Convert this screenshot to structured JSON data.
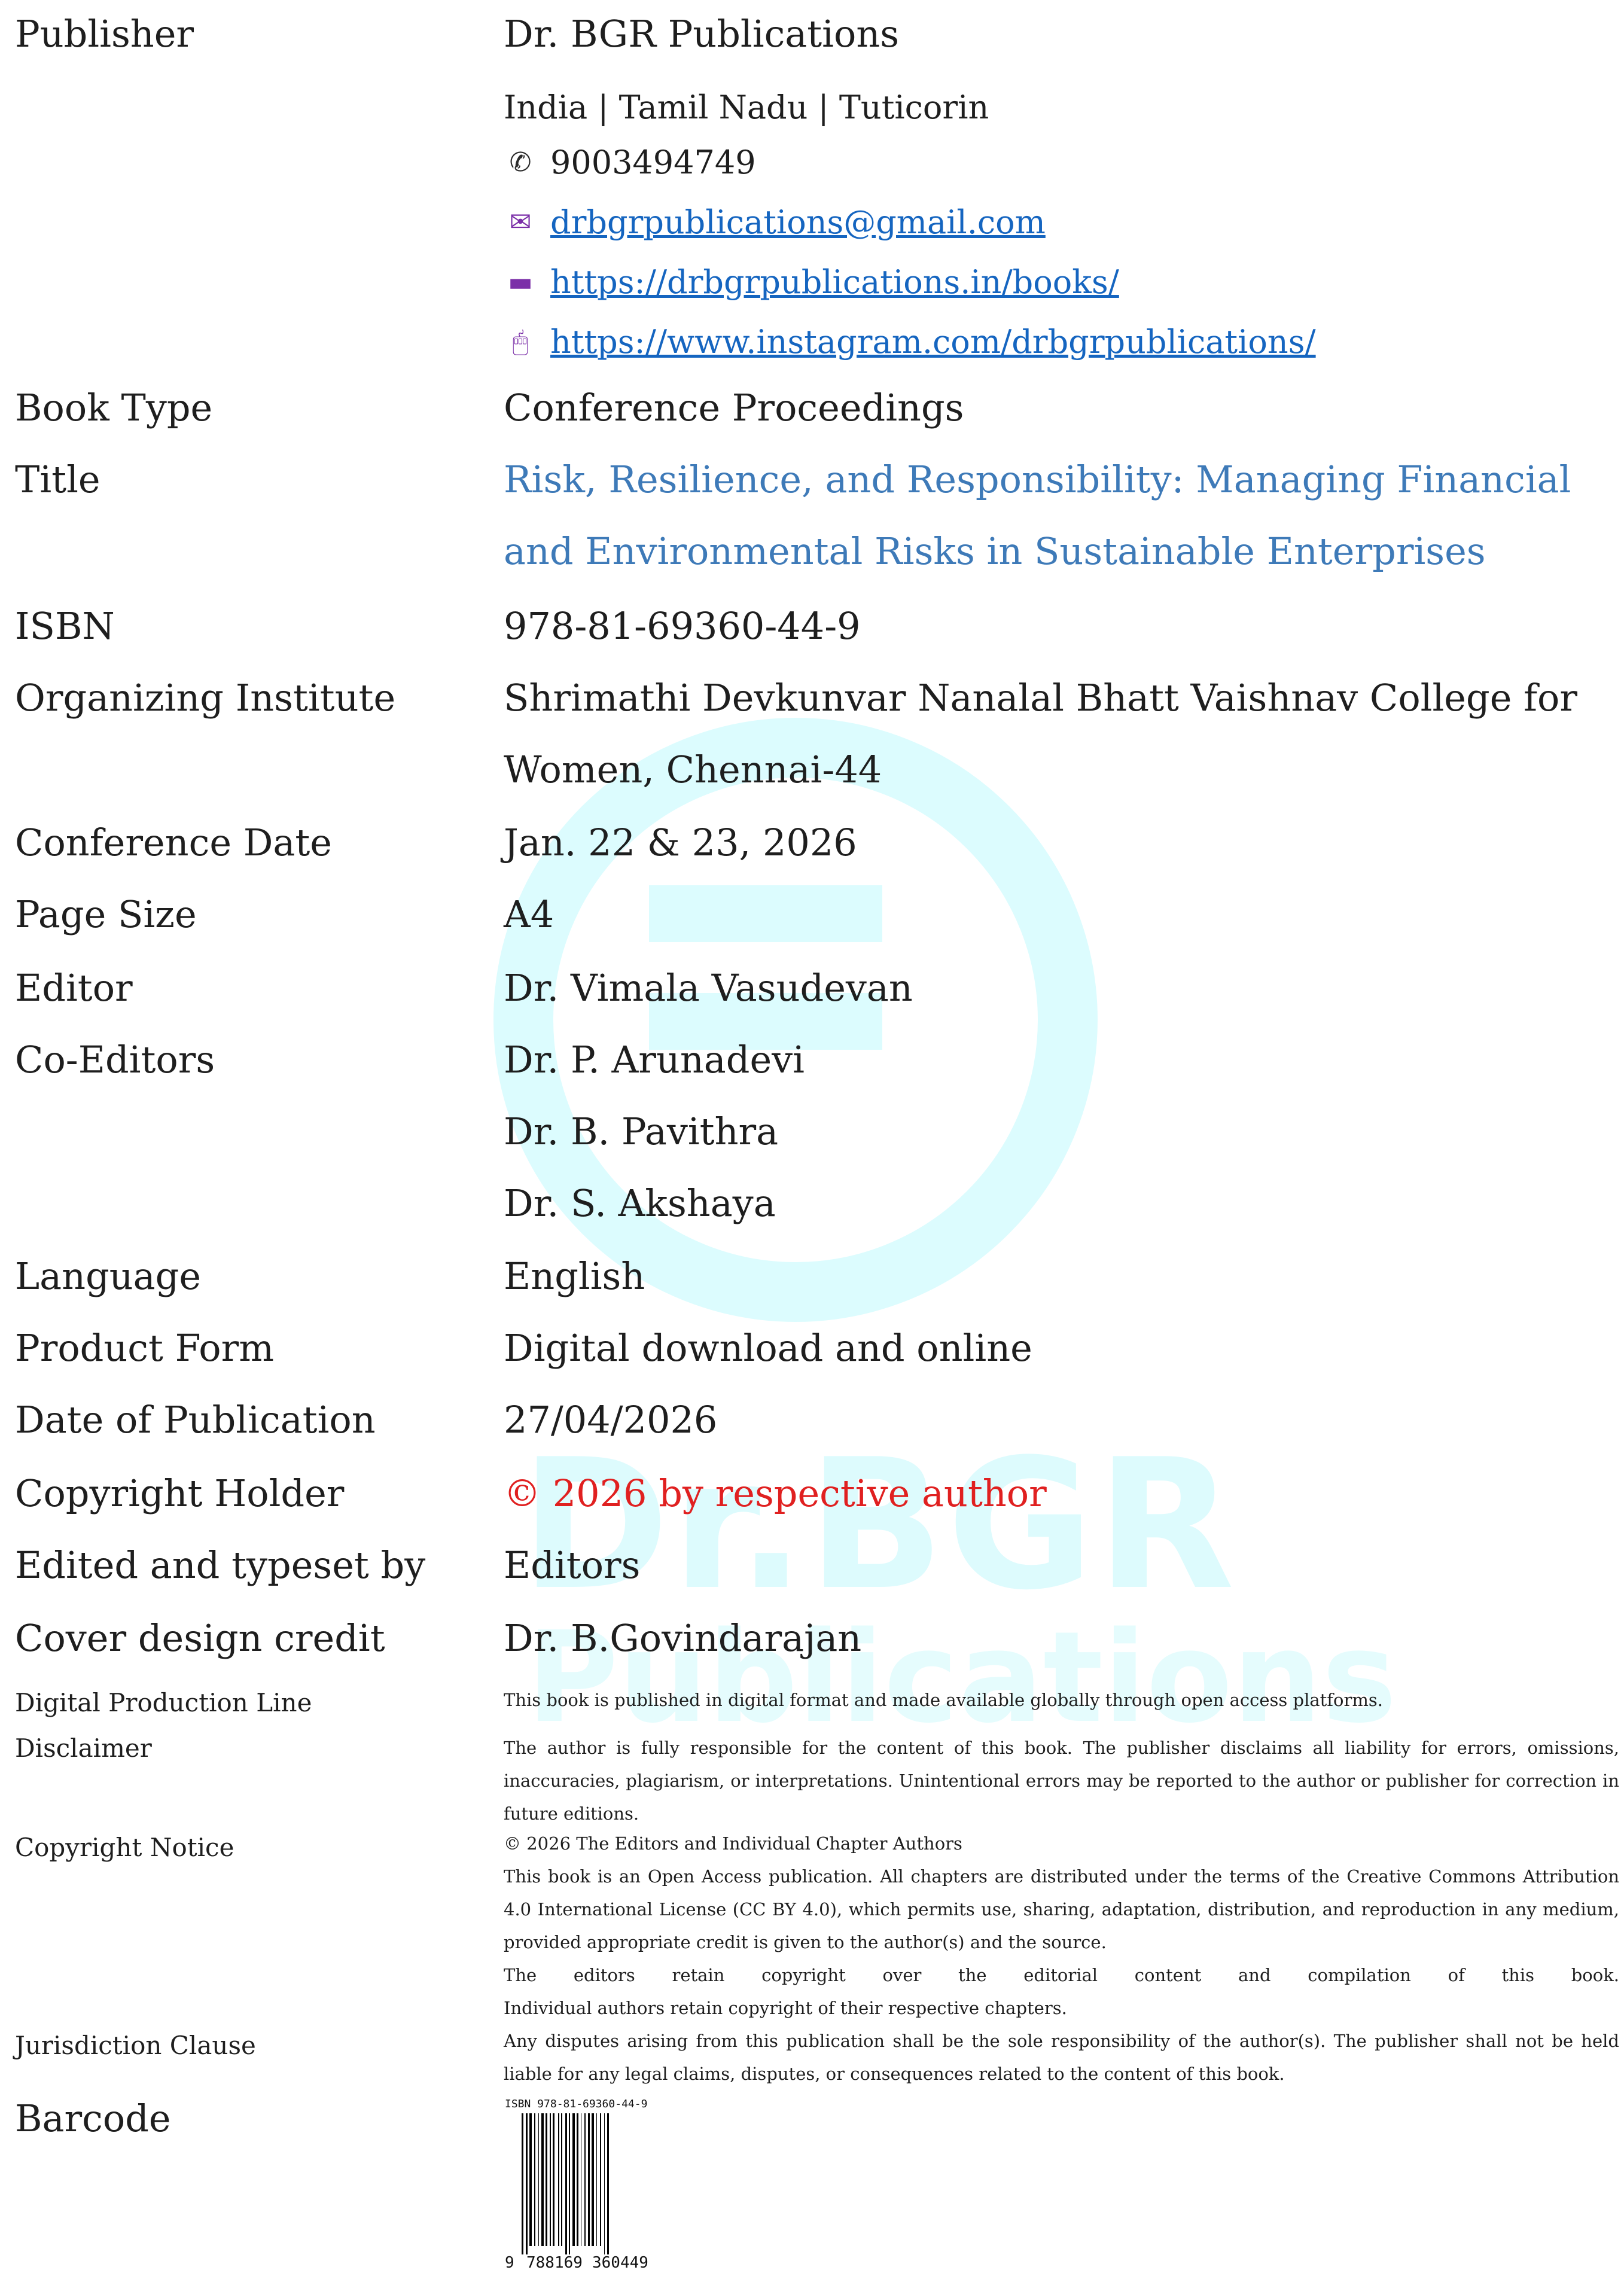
{
  "publisher": {
    "label": "Publisher",
    "name": "Dr. BGR Publications",
    "location": "India | Tamil Nadu | Tuticorin",
    "phone": "9003494749",
    "email": "drbgrpublications@gmail.com",
    "website": "https://drbgrpublications.in/books/",
    "instagram": "https://www.instagram.com/drbgrpublications/",
    "icons": [
      "phone-icon",
      "mail-icon",
      "laptop-icon",
      "mouse-icon"
    ]
  },
  "fields": {
    "book_type": {
      "label": "Book Type",
      "value": "Conference Proceedings"
    },
    "title": {
      "label": "Title",
      "line1": "Risk, Resilience, and Responsibility: Managing Financial",
      "line2": "and Environmental Risks in Sustainable Enterprises"
    },
    "isbn": {
      "label": "ISBN",
      "value": "978-81-69360-44-9"
    },
    "institute": {
      "label": "Organizing Institute",
      "line1": "Shrimathi Devkunvar Nanalal Bhatt Vaishnav College for",
      "line2": "Women, Chennai-44"
    },
    "conference_date": {
      "label": "Conference Date",
      "value": "Jan. 22 & 23, 2026"
    },
    "page_size": {
      "label": "Page Size",
      "value": "A4"
    },
    "editor": {
      "label": "Editor",
      "value": "Dr. Vimala Vasudevan"
    },
    "co_editors": {
      "label": "Co-Editors",
      "names": [
        "Dr. P. Arunadevi",
        "Dr. B. Pavithra",
        "Dr. S. Akshaya"
      ]
    },
    "language": {
      "label": "Language",
      "value": "English"
    },
    "product_form": {
      "label": "Product Form",
      "value": "Digital download and online"
    },
    "publication_date": {
      "label": "Date of Publication",
      "value": "27/04/2026"
    },
    "copyright_holder": {
      "label": "Copyright Holder",
      "value": "© 2026 by respective author"
    },
    "typeset": {
      "label": "Edited and typeset by",
      "value": "Editors"
    },
    "cover_design": {
      "label": "Cover design credit",
      "value": "Dr. B.Govindarajan"
    }
  },
  "small": {
    "production_label": "Digital Production Line",
    "production_text": "This book is published in digital format and made available globally through open access platforms.",
    "disclaimer_label": "Disclaimer",
    "disclaimer_text": "The author is fully responsible for the content of this book. The publisher disclaims all liability for errors, omissions, inaccuracies, plagiarism, or interpretations. Unintentional errors may be reported to the author or publisher for correction in future editions.",
    "copyright_label": "Copyright Notice",
    "copyright_line": "© 2026 The Editors and Individual Chapter Authors",
    "copyright_text": "This book is an Open Access publication. All chapters are distributed under the terms of the Creative Commons Attribution 4.0 International License (CC BY 4.0), which permits use, sharing, adaptation, distribution, and reproduction in any medium, provided appropriate credit is given to the author(s) and the source.",
    "copyright_text2a": "The editors retain copyright over the editorial content and compilation of this book.",
    "copyright_text2b": "Individual authors retain copyright of their respective chapters.",
    "jurisdiction_label": "Jurisdiction Clause",
    "jurisdiction_text": "Any disputes arising from this publication shall be the sole responsibility of the author(s). The publisher shall not be held liable for any legal claims, disputes, or consequences related to the content of this book.",
    "barcode_label": "Barcode",
    "barcode_isbn": "ISBN 978-81-69360-44-9",
    "barcode_lead": "9",
    "barcode_g1": "788169",
    "barcode_g2": "360449"
  },
  "watermark": {
    "text1": "Dr.BGR",
    "text2": "Publications"
  },
  "colors": {
    "title": "#3e7ab8",
    "link": "#1565c0",
    "copyright": "#e02020",
    "watermark": "#dcfcfe",
    "icon_purple": "#7b2fa8"
  }
}
